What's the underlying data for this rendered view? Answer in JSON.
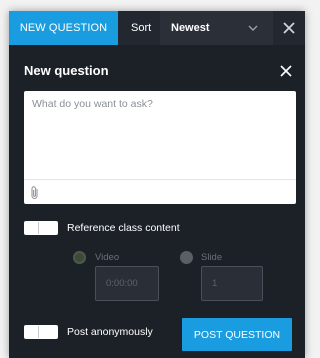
{
  "topbar": {
    "new_question_label": "NEW QUESTION",
    "sort_label": "Sort",
    "sort_value": "Newest"
  },
  "dialog": {
    "title": "New question",
    "question_placeholder": "What do you want to ask?",
    "reference_label": "Reference class content",
    "video_label": "Video",
    "video_placeholder": "0:00:00",
    "slide_label": "Slide",
    "slide_placeholder": "1",
    "anonymous_label": "Post anonymously",
    "post_label": "POST QUESTION"
  },
  "icons": {
    "top_close": "close-icon",
    "dialog_close": "close-icon",
    "sort_chevron": "chevron-down-icon",
    "attach": "paperclip-icon"
  },
  "colors": {
    "accent": "#1a9de0",
    "panel_bg": "#1c2128",
    "topbar_bg": "#232830"
  },
  "state": {
    "reference_class_content": false,
    "post_anonymously": false
  }
}
